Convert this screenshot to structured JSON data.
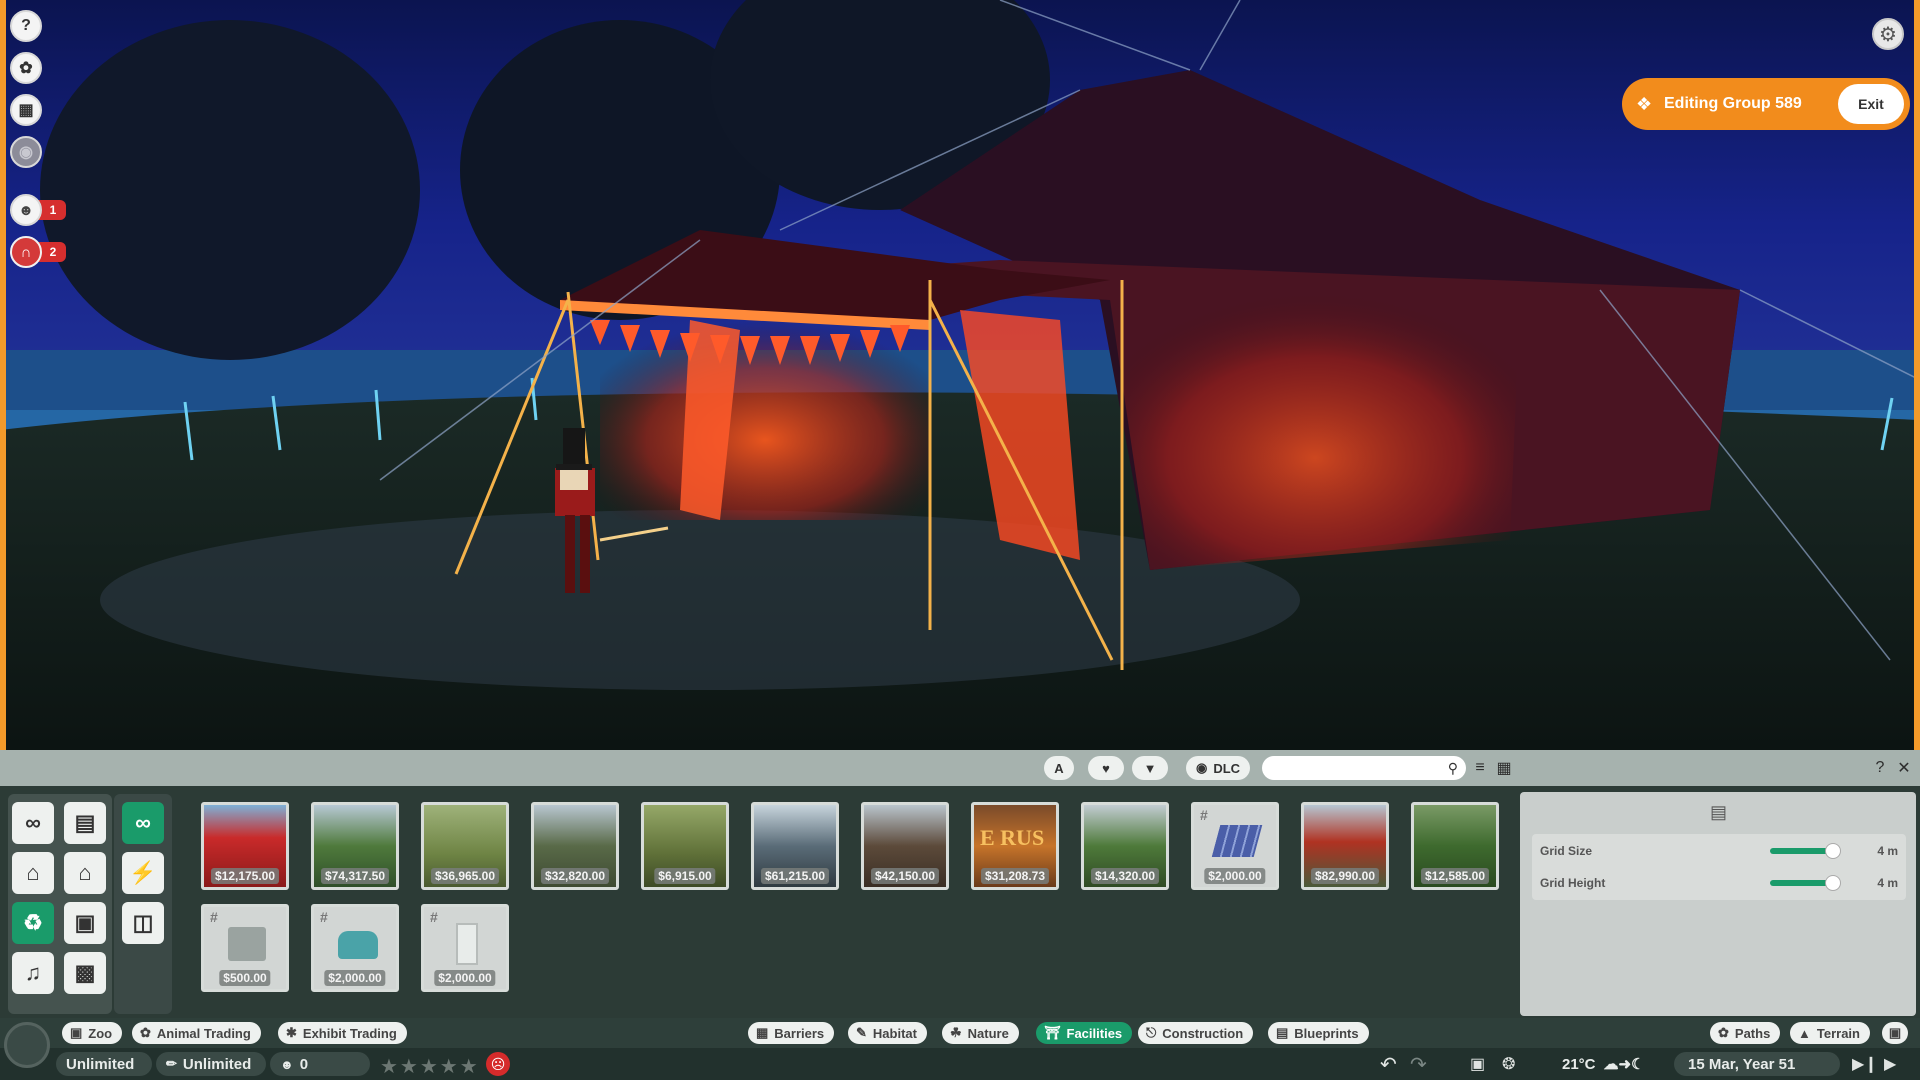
{
  "left_toolbar": {
    "help_icon": "help-icon",
    "animal_icon": "paw-icon",
    "calendar_icon": "calendar-icon",
    "visibility_icon": "eye-icon",
    "staff_count": "1",
    "habitat_count": "2"
  },
  "editing": {
    "label": "Editing Group 589",
    "exit_label": "Exit"
  },
  "panel_toolbar": {
    "dlc_label": "DLC",
    "search_placeholder": ""
  },
  "items": [
    {
      "price": "$12,175.00"
    },
    {
      "price": "$74,317.50"
    },
    {
      "price": "$36,965.00"
    },
    {
      "price": "$32,820.00"
    },
    {
      "price": "$6,915.00"
    },
    {
      "price": "$61,215.00"
    },
    {
      "price": "$42,150.00"
    },
    {
      "price": "$31,208.73",
      "thumb_text": "E RUS"
    },
    {
      "price": "$14,320.00"
    },
    {
      "price": "$2,000.00"
    },
    {
      "price": "$82,990.00"
    },
    {
      "price": "$12,585.00"
    },
    {
      "price": "$500.00"
    },
    {
      "price": "$2,000.00"
    },
    {
      "price": "$2,000.00"
    }
  ],
  "grid_settings": {
    "grid_size_label": "Grid Size",
    "grid_size_value": "4 m",
    "grid_height_label": "Grid Height",
    "grid_height_value": "4 m",
    "grid_size_level": 0.85,
    "grid_height_level": 0.85
  },
  "tabs_left": [
    {
      "label": "Zoo"
    },
    {
      "label": "Animal Trading"
    },
    {
      "label": "Exhibit Trading"
    }
  ],
  "tabs_center": [
    {
      "label": "Barriers"
    },
    {
      "label": "Habitat"
    },
    {
      "label": "Nature"
    },
    {
      "label": "Facilities"
    },
    {
      "label": "Construction"
    },
    {
      "label": "Blueprints"
    }
  ],
  "tabs_right": [
    {
      "label": "Paths"
    },
    {
      "label": "Terrain"
    }
  ],
  "status": {
    "money": "Unlimited",
    "research": "Unlimited",
    "guests": "0",
    "temperature": "21°C",
    "date": "15 Mar, Year 51"
  },
  "colors": {
    "accent_orange": "#f28c1c",
    "accent_green": "#1a9b6a",
    "alert_red": "#d62e2e"
  }
}
